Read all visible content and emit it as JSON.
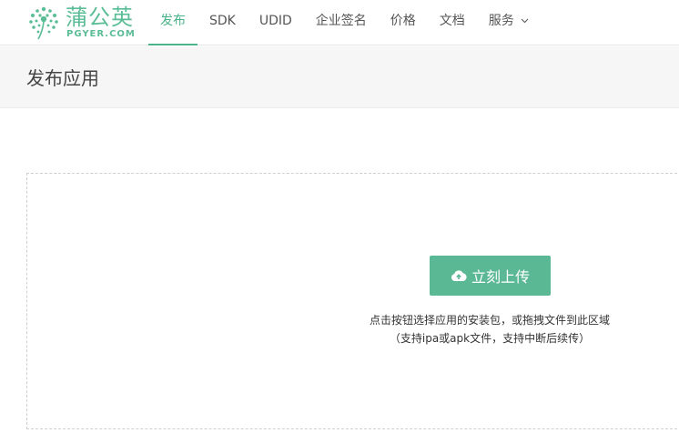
{
  "brand": {
    "name_cn": "蒲公英",
    "name_en": "PGYER.COM",
    "color": "#5bbd96"
  },
  "nav": {
    "items": [
      {
        "label": "发布",
        "active": true
      },
      {
        "label": "SDK"
      },
      {
        "label": "UDID"
      },
      {
        "label": "企业签名"
      },
      {
        "label": "价格"
      },
      {
        "label": "文档"
      },
      {
        "label": "服务",
        "has_dropdown": true
      }
    ]
  },
  "page": {
    "title": "发布应用"
  },
  "upload": {
    "button_label": "立刻上传",
    "button_icon": "cloud-upload-icon",
    "hint_line1": "点击按钮选择应用的安装包，或拖拽文件到此区域",
    "hint_line2": "（支持ipa或apk文件，支持中断后续传）"
  },
  "colors": {
    "accent": "#4ab389",
    "button": "#5bb894"
  }
}
